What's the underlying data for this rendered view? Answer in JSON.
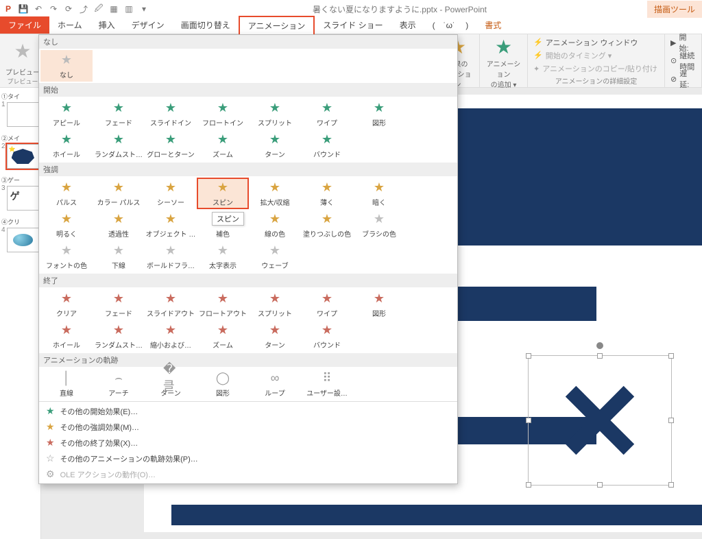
{
  "title": "暑くない夏になりますように.pptx - PowerPoint",
  "drawing_tools_tab": "描画ツール",
  "tabs": {
    "file": "ファイル",
    "home": "ホーム",
    "insert": "挿入",
    "design": "デザイン",
    "transitions": "画面切り替え",
    "animations": "アニメーション",
    "slideshow": "スライド ショー",
    "view": "表示",
    "emoji": "(　˙ω˙ 　)",
    "format": "書式"
  },
  "ribbon": {
    "preview": "プレビュー",
    "preview_group": "プレビュー",
    "effect_options": "効果の\nオプション",
    "add_animation": "アニメーション\nの追加 ▾",
    "adv_window": "アニメーション ウィンドウ",
    "adv_trigger": "開始のタイミング ▾",
    "adv_painter": "アニメーションのコピー/貼り付け",
    "adv_group": "アニメーションの詳細設定",
    "start_label": "開始:",
    "duration_label": "継続時間",
    "delay_label": "遅延:"
  },
  "gallery": {
    "sec_none": "なし",
    "none": "なし",
    "sec_entrance": "開始",
    "entrance": [
      "アピール",
      "フェード",
      "スライドイン",
      "フロートイン",
      "スプリット",
      "ワイプ",
      "図形",
      "ホイール",
      "ランダムスト…",
      "グローとターン",
      "ズーム",
      "ターン",
      "バウンド"
    ],
    "sec_emphasis": "強調",
    "emphasis": [
      "パルス",
      "カラー パルス",
      "シーソー",
      "スピン",
      "拡大/収縮",
      "薄く",
      "暗く",
      "明るく",
      "透過性",
      "オブジェクト …",
      "補色",
      "線の色",
      "塗りつぶしの色",
      "ブラシの色",
      "フォントの色",
      "下線",
      "ボールドフラ…",
      "太字表示",
      "ウェーブ"
    ],
    "sec_exit": "終了",
    "exit": [
      "クリア",
      "フェード",
      "スライドアウト",
      "フロートアウト",
      "スプリット",
      "ワイプ",
      "図形",
      "ホイール",
      "ランダムスト…",
      "縮小および…",
      "ズーム",
      "ターン",
      "バウンド"
    ],
    "sec_motion": "アニメーションの軌跡",
    "motion": [
      "直線",
      "アーチ",
      "ターン",
      "図形",
      "ループ",
      "ユーザー設…"
    ],
    "tooltip_spin": "スピン",
    "footer": {
      "more_entrance": "その他の開始効果(E)…",
      "more_emphasis": "その他の強調効果(M)…",
      "more_exit": "その他の終了効果(X)…",
      "more_motion": "その他のアニメーションの軌跡効果(P)…",
      "ole": "OLE アクションの動作(O)…"
    }
  },
  "thumbs": {
    "t1": "①タイ",
    "t2": "②メイ",
    "t3": "③ゲー",
    "t4": "④クリ",
    "t3_text": "ゲ"
  }
}
